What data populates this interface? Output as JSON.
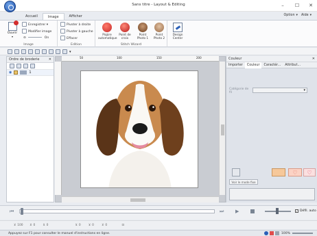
{
  "window": {
    "title": "Sans titre - Layout & Editing",
    "minimize": "–",
    "maximize": "☐",
    "close": "✕"
  },
  "ribbon_tabs": [
    "Accueil",
    "Image",
    "Afficher"
  ],
  "active_tab": "Image",
  "top_right": {
    "option": "Option",
    "aide": "Aide"
  },
  "ribbon": {
    "image_group": {
      "label": "Image",
      "ouvrir": "Ouvrir",
      "enregistrer": "Enregistrer",
      "modifier": "Modifier image",
      "toggle_glyph": "⊝",
      "toggle_label": "On"
    },
    "edition_group": {
      "label": "Edition",
      "pivoter_droite": "Pivoter à droite",
      "pivoter_gauche": "Pivoter à gauche",
      "effacer": "Effacer"
    },
    "stitch_group": {
      "label": "Stitch Wizard",
      "buttons": [
        {
          "line1": "Piqûre",
          "line2": "automatique"
        },
        {
          "line1": "Point de",
          "line2": "croix"
        },
        {
          "line1": "Point",
          "line2": "Photo 1"
        },
        {
          "line1": "Point",
          "line2": "Photo 2"
        }
      ]
    },
    "design_center": {
      "line1": "Design",
      "line2": "Center"
    }
  },
  "left_panel": {
    "title": "Ordre de broderie",
    "close": "✕",
    "items": [
      {
        "label": "1"
      }
    ]
  },
  "ruler_marks": [
    "50",
    "100",
    "150",
    "200"
  ],
  "right_panel": {
    "title": "Couleur",
    "close": "✕",
    "tabs": [
      "Importer",
      "Couleur",
      "Caractér...",
      "Attribut..."
    ],
    "selected_tab": "Couleur",
    "field_label": "Catégorie de fil",
    "view_button": "Voir le mode fixe"
  },
  "player": {
    "checkbox_label": "Défil. auto"
  },
  "bottom_tools": [
    "100",
    "0",
    "0",
    "0",
    "0",
    "0"
  ],
  "status": {
    "text": "Appuyez sur F1 pour consulter le manuel d'instructions en ligne.",
    "zoom": "100%"
  },
  "colors": {
    "accent": "#2a5fb8",
    "ribbon_bg": "#fbfbfc",
    "panel_bg": "#dfe3ea"
  }
}
